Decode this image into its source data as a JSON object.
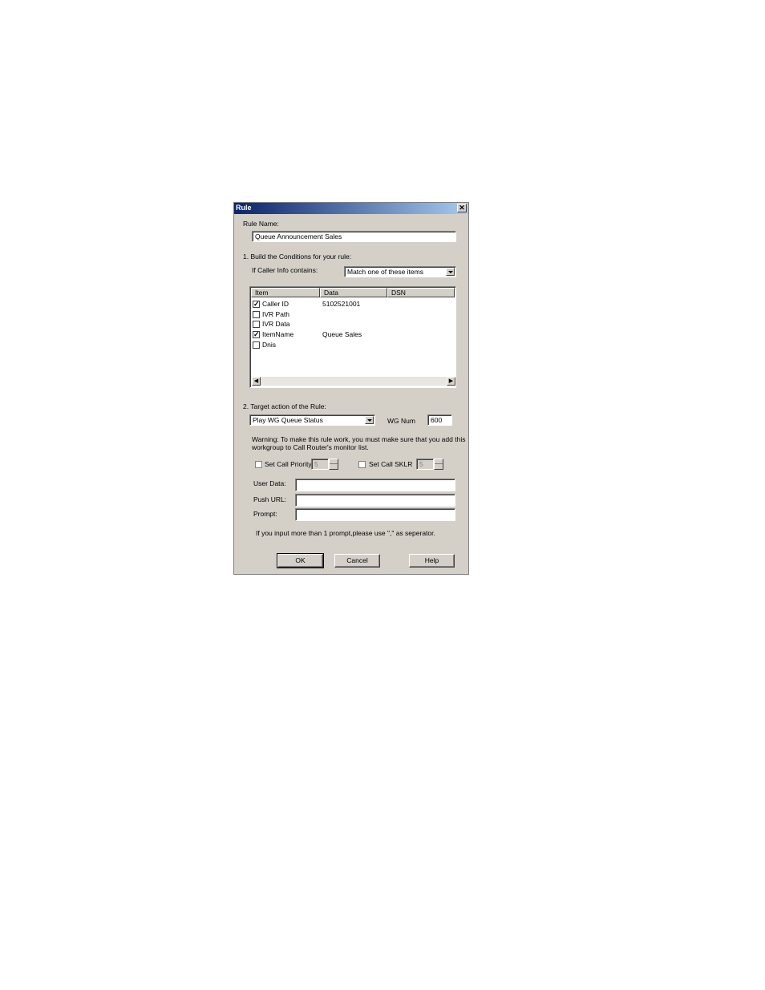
{
  "window": {
    "title": "Rule",
    "close_glyph": "✕"
  },
  "rule_name": {
    "label": "Rule Name:",
    "value": "Queue Announcement Sales"
  },
  "conditions": {
    "heading": "1. Build the Conditions for your rule:",
    "caller_info_label": "If Caller Info contains:",
    "match_value": "Match one of these items",
    "columns": [
      "Item",
      "Data",
      "DSN"
    ],
    "rows": [
      {
        "item": "Caller ID",
        "data": "5102521001",
        "dsn": "",
        "checked": true
      },
      {
        "item": "IVR Path",
        "data": "",
        "dsn": "",
        "checked": false
      },
      {
        "item": "IVR Data",
        "data": "",
        "dsn": "",
        "checked": false
      },
      {
        "item": "ItemName",
        "data": "Queue Sales",
        "dsn": "",
        "checked": true
      },
      {
        "item": "Dnis",
        "data": "",
        "dsn": "",
        "checked": false
      }
    ]
  },
  "target": {
    "heading": "2. Target action of the Rule:",
    "action_value": "Play WG Queue Status",
    "wg_num_label": "WG Num",
    "wg_num_value": "600",
    "warning_line1": "Warning: To make this rule work, you must make sure that you add this",
    "warning_line2": "workgroup to Call Router's monitor list.",
    "priority_label": "Set Call Priority",
    "priority_value": "5",
    "sklr_label": "Set Call SKLR",
    "sklr_value": "5",
    "user_data_label": "User Data:",
    "user_data_value": "",
    "push_url_label": "Push URL:",
    "push_url_value": "",
    "prompt_label": "Prompt:",
    "prompt_value": "",
    "prompt_hint": "If you input more than 1 prompt,please use \",\" as seperator."
  },
  "buttons": {
    "ok": "OK",
    "cancel": "Cancel",
    "help": "Help"
  },
  "icons": {
    "scroll_left": "scroll-left-arrow-icon",
    "scroll_right": "scroll-right-arrow-icon"
  }
}
